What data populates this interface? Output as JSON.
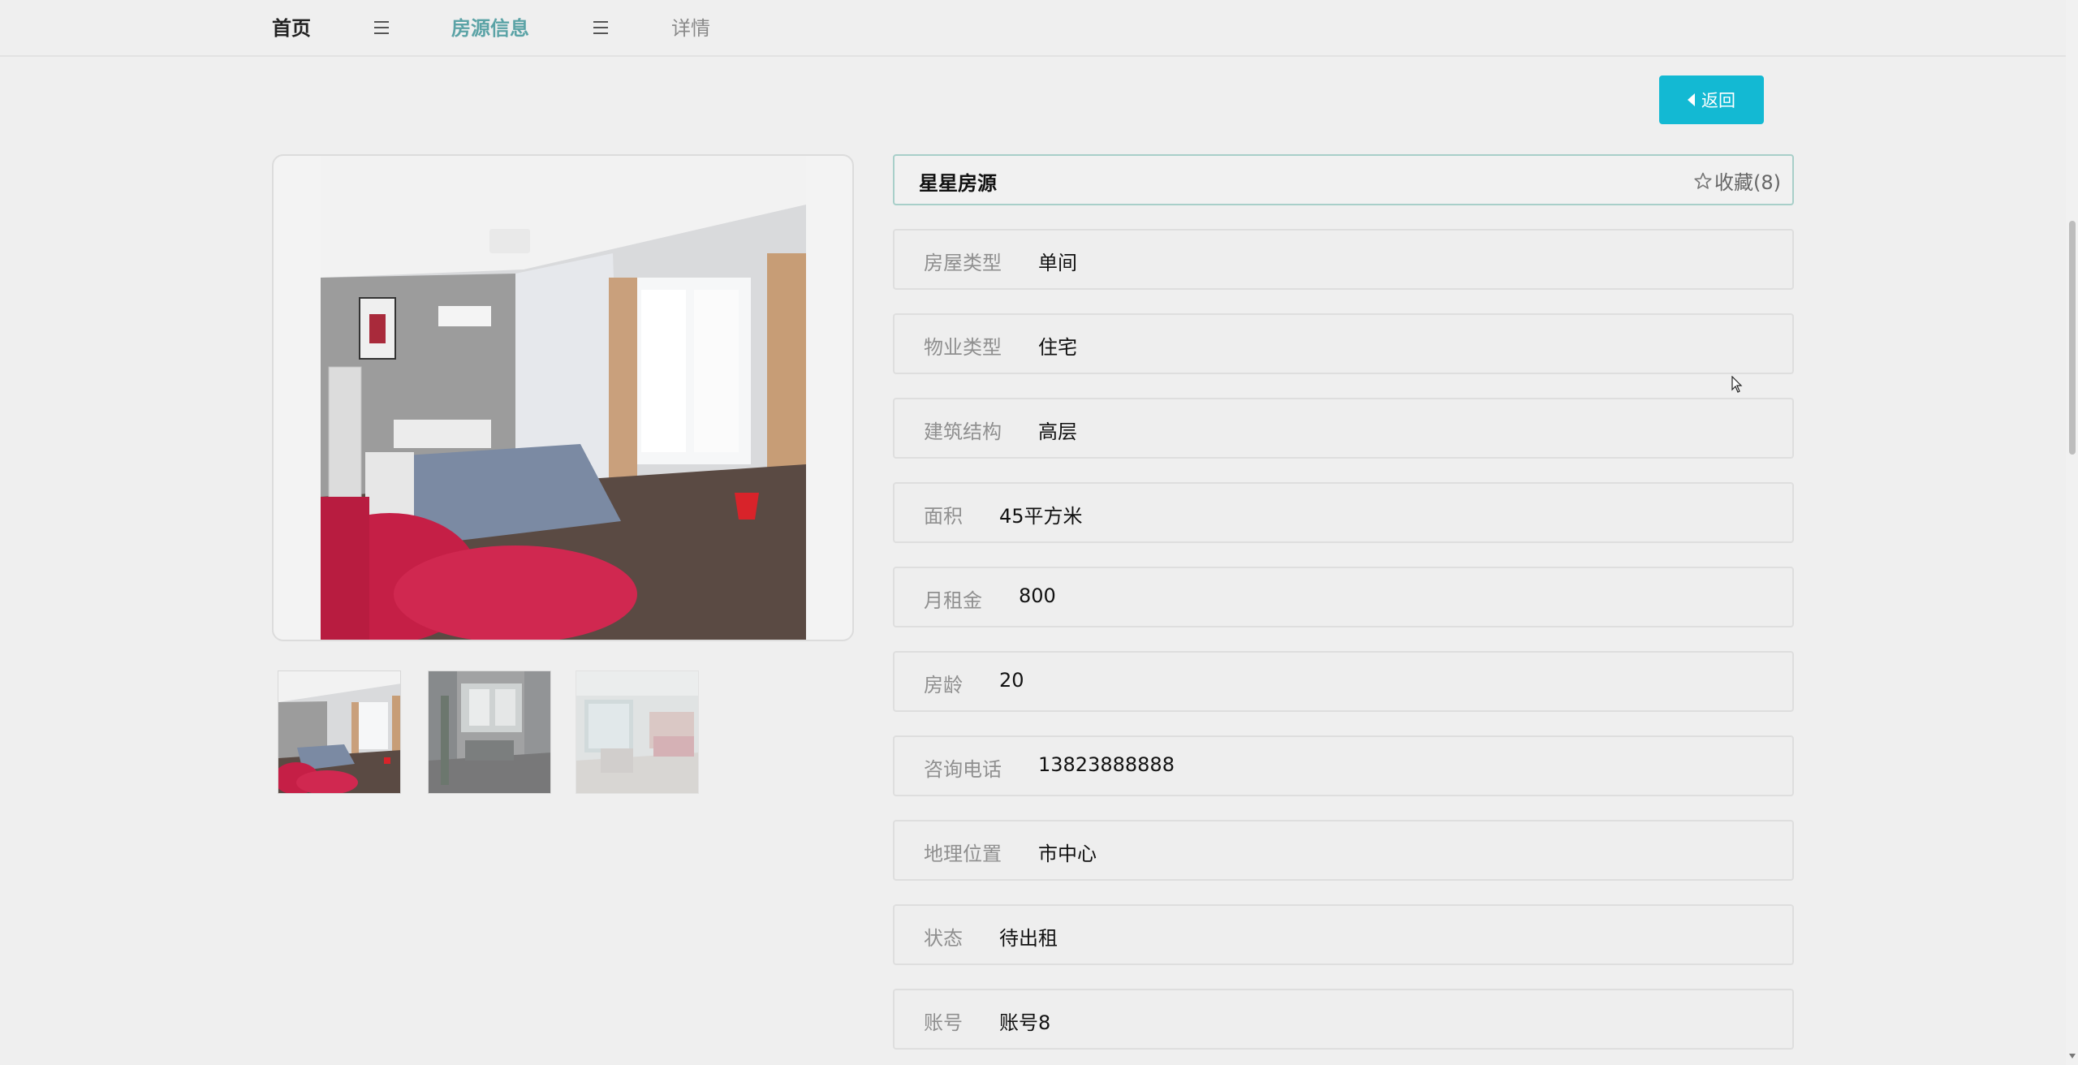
{
  "breadcrumb": {
    "home": "首页",
    "current": "房源信息",
    "detail": "详情"
  },
  "back_button": {
    "label": "返回"
  },
  "listing": {
    "title": "星星房源",
    "favorite_label": "收藏(8)"
  },
  "details": [
    {
      "label": "房屋类型",
      "value": "单间"
    },
    {
      "label": "物业类型",
      "value": "住宅"
    },
    {
      "label": "建筑结构",
      "value": "高层"
    },
    {
      "label": "面积",
      "value": "45平方米"
    },
    {
      "label": "月租金",
      "value": "800"
    },
    {
      "label": "房龄",
      "value": "20"
    },
    {
      "label": "咨询电话",
      "value": "13823888888"
    },
    {
      "label": "地理位置",
      "value": "市中心"
    },
    {
      "label": "状态",
      "value": "待出租"
    },
    {
      "label": "账号",
      "value": "账号8"
    }
  ],
  "colors": {
    "accent": "#5ba3a6",
    "button": "#13b9d3",
    "title_border": "#a8cfc9"
  }
}
